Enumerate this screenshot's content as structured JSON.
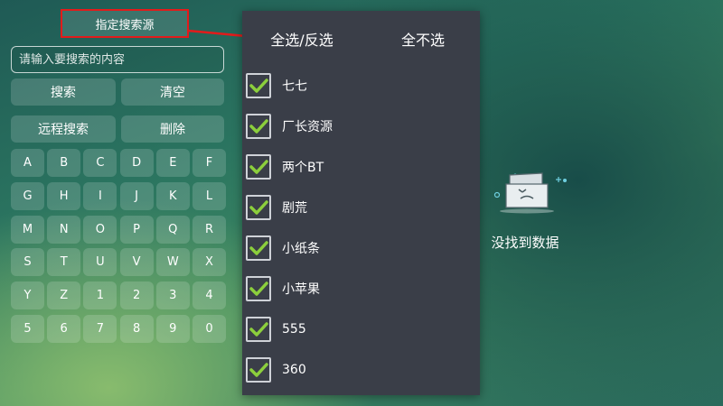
{
  "toolbar": {
    "source_label": "指定搜索源",
    "search_placeholder": "请输入要搜索的内容",
    "search_value": "",
    "search_label": "搜索",
    "clear_label": "清空",
    "remote_search_label": "远程搜索",
    "delete_label": "删除"
  },
  "keyboard": {
    "keys": [
      "A",
      "B",
      "C",
      "D",
      "E",
      "F",
      "G",
      "H",
      "I",
      "J",
      "K",
      "L",
      "M",
      "N",
      "O",
      "P",
      "Q",
      "R",
      "S",
      "T",
      "U",
      "V",
      "W",
      "X",
      "Y",
      "Z",
      "1",
      "2",
      "3",
      "4",
      "5",
      "6",
      "7",
      "8",
      "9",
      "0"
    ]
  },
  "source_panel": {
    "select_all_label": "全选/反选",
    "select_none_label": "全不选",
    "items": [
      {
        "label": "七七",
        "checked": true
      },
      {
        "label": "厂长资源",
        "checked": true
      },
      {
        "label": "两个BT",
        "checked": true
      },
      {
        "label": "剧荒",
        "checked": true
      },
      {
        "label": "小纸条",
        "checked": true
      },
      {
        "label": "小苹果",
        "checked": true
      },
      {
        "label": "555",
        "checked": true
      },
      {
        "label": "360",
        "checked": true
      }
    ]
  },
  "result": {
    "empty_text": "没找到数据",
    "empty_icon": "empty-box-icon"
  },
  "colors": {
    "accent_check": "#8ccf3c",
    "highlight_border": "#e31b1b",
    "panel_bg": "#3a3e48"
  }
}
